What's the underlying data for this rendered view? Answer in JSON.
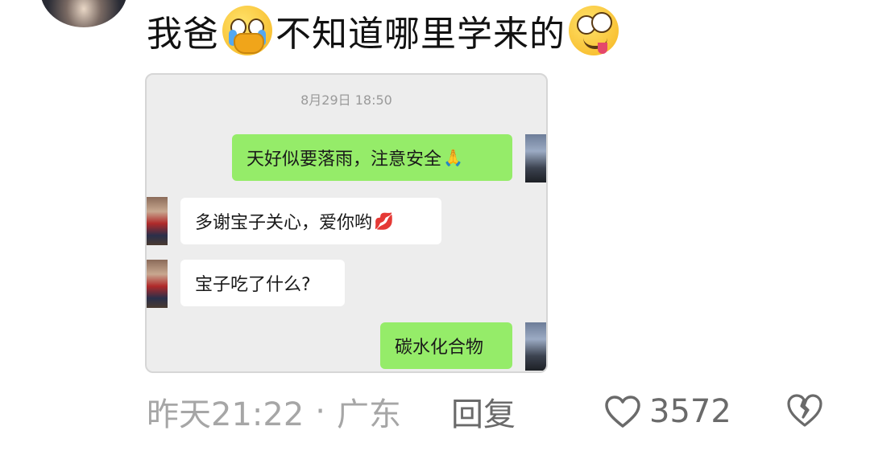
{
  "comment": {
    "text_part1": "我爸",
    "emoji1": "crying-face-hands-over-mouth-emoji",
    "text_part2": "不知道哪里学来的",
    "emoji2": "crazy-face-emoji"
  },
  "chat_screenshot": {
    "timestamp": "8月29日 18:50",
    "messages": [
      {
        "side": "right",
        "text": "天好似要落雨，注意安全",
        "emoji": "🙏",
        "bubble_color": "#95ec69"
      },
      {
        "side": "left",
        "text": "多谢宝子关心，爱你哟",
        "emoji": "💋",
        "bubble_color": "#ffffff"
      },
      {
        "side": "left",
        "text": "宝子吃了什么?",
        "emoji": "",
        "bubble_color": "#ffffff"
      },
      {
        "side": "right",
        "text": "碳水化合物",
        "emoji": "",
        "bubble_color": "#95ec69"
      }
    ]
  },
  "meta": {
    "time": "昨天21:22",
    "separator": "·",
    "location": "广东",
    "reply_label": "回复",
    "like_count": "3572"
  },
  "icons": {
    "like": "heart-outline-icon",
    "dislike": "broken-heart-icon"
  }
}
